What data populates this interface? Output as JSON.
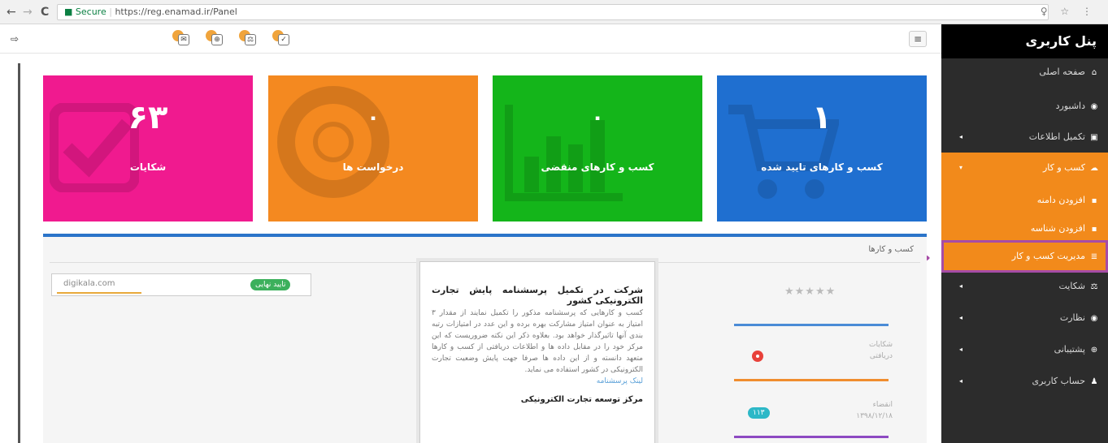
{
  "browser": {
    "back": "←",
    "forward": "→",
    "reload": "C",
    "secure_label": "Secure",
    "url": "https://reg.enamad.ir/Panel",
    "right_icons": "♀ ☆ ⋮"
  },
  "toolbar": {
    "exit_icon": "⇨",
    "icons": [
      "✉",
      "⊕",
      "⚖",
      "✓"
    ],
    "menu_toggle": "≡"
  },
  "sidebar": {
    "title": "پنل کاربری",
    "items": [
      {
        "label": "صفحه اصلی",
        "icon": "home-icon",
        "glyph": "⌂",
        "caret": ""
      },
      {
        "label": "داشبورد",
        "icon": "dashboard-icon",
        "glyph": "◉",
        "caret": ""
      },
      {
        "label": "تکمیل اطلاعات",
        "icon": "id-card-icon",
        "glyph": "▣",
        "caret": "◂"
      },
      {
        "label": "کسب و کار",
        "icon": "cloud-icon",
        "glyph": "☁",
        "caret": "▾"
      },
      {
        "label": "افزودن دامنه",
        "icon": "plus-square-icon",
        "glyph": "▪",
        "caret": ""
      },
      {
        "label": "افزودن شناسه",
        "icon": "plus-square-icon",
        "glyph": "▪",
        "caret": ""
      },
      {
        "label": "مدیریت کسب و کار",
        "icon": "list-icon",
        "glyph": "≣",
        "caret": ""
      },
      {
        "label": "شکایت",
        "icon": "scale-icon",
        "glyph": "⚖",
        "caret": "◂"
      },
      {
        "label": "نظارت",
        "icon": "eye-icon",
        "glyph": "◉",
        "caret": "◂"
      },
      {
        "label": "پشتیبانی",
        "icon": "lifebuoy-icon",
        "glyph": "⊕",
        "caret": "◂"
      },
      {
        "label": "حساب کاربری",
        "icon": "user-icon",
        "glyph": "♟",
        "caret": "◂"
      }
    ]
  },
  "cards": [
    {
      "value": "۶۳",
      "label": "شکایات",
      "color": "#f01a8f"
    },
    {
      "value": "۰",
      "label": "درخواست ها",
      "color": "#f48920"
    },
    {
      "value": "۰",
      "label": "کسب و کارهای منقضی",
      "color": "#14b51a"
    },
    {
      "value": "۱",
      "label": "کسب و کارهای تایید شده",
      "color": "#1f6fd0"
    }
  ],
  "panel": {
    "title": "کسب و کارها",
    "domain": "digikala.com",
    "status_badge": "تایید نهایی",
    "rating_stars": "★★★★★",
    "complaints_label_1": "شکایات",
    "complaints_label_2": "دریافتی",
    "expiry_label": "انقضاء",
    "expiry_date": "۱۳۹۸/۱۲/۱۸",
    "count_badge": "۱۱۳"
  },
  "notice": {
    "title": "شرکت در تکمیل پرسشنامه پایش تجارت الکترونیکی کشور",
    "body": "کسب و کارهایی که پرسشنامه مذکور را تکمیل نمایند از مقدار ۳ امتیاز به عنوان امتیاز مشارکت بهره برده و این عدد در امتیازات رتبه بندی آنها تاثیرگذار خواهد بود. بعلاوه ذکر این نکته ضروریست که این مرکز خود را در مقابل داده ها و اطلاعات دریافتی از کسب و کارها متعهد دانسته و از این داده ها صرفا جهت پایش وضعیت تجارت الکترونیکی در کشور استفاده می نماید.",
    "link": "لینک پرسشنامه",
    "footer": "مرکز توسعه تجارت الکترونیکی"
  },
  "colors": {
    "sidebar_bg": "#2c2c2c",
    "sidebar_active": "#f28a1b",
    "highlight_outline": "#a64ca6",
    "panel_accent": "#2b74c9"
  }
}
